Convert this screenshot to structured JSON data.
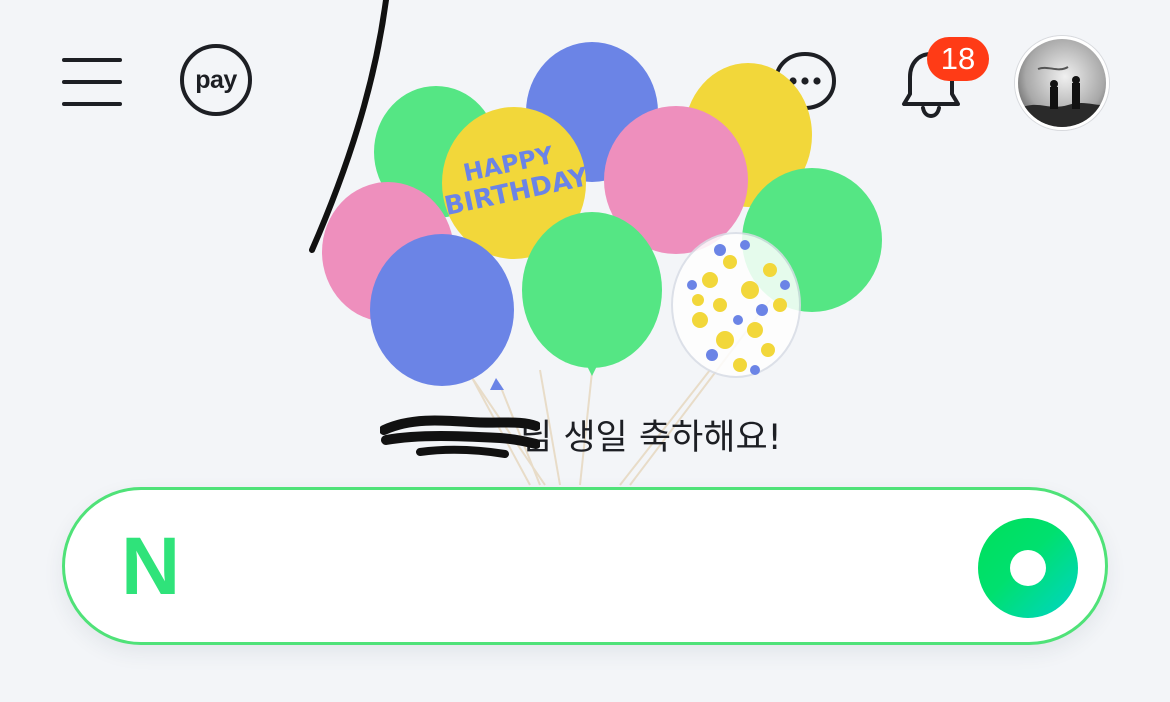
{
  "header": {
    "pay_label": "pay",
    "notification_count": "18"
  },
  "hero": {
    "balloon_text_line1": "HAPPY",
    "balloon_text_line2": "BIRTHDAY",
    "greeting": "님 생일 축하해요!"
  },
  "search": {
    "logo": "N",
    "placeholder": ""
  },
  "colors": {
    "background": "#f3f5f8",
    "naver_green": "#2fe37a",
    "search_border": "#4fe278",
    "badge_red": "#ff3b16"
  }
}
